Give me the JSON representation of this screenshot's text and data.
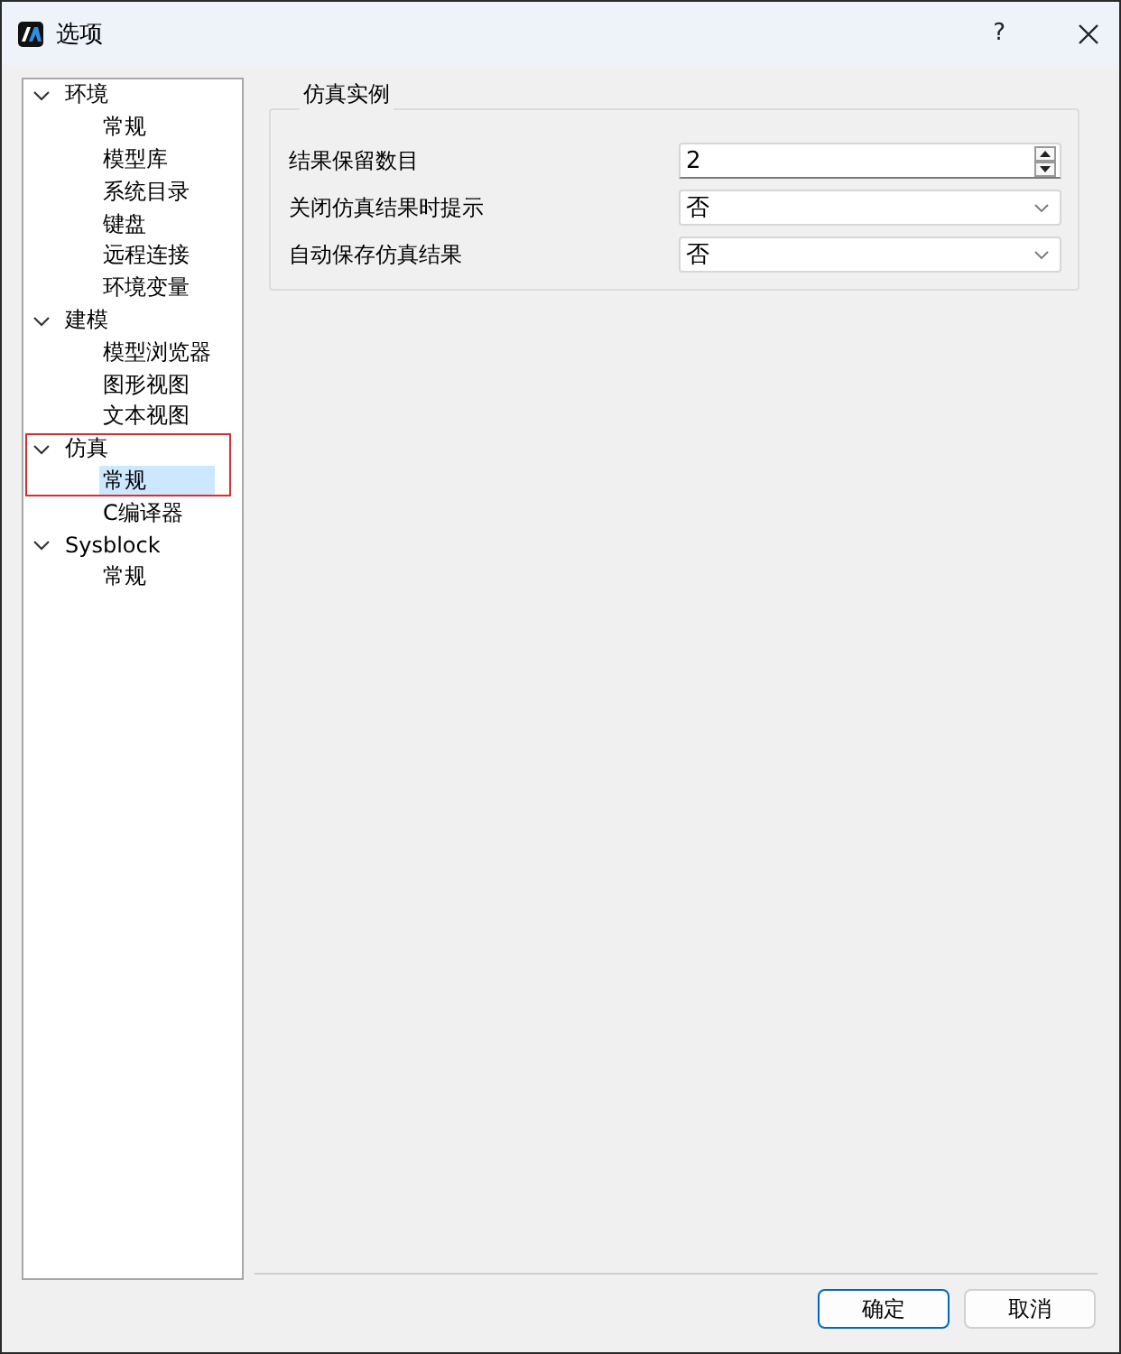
{
  "window": {
    "title": "选项",
    "help_button": "?"
  },
  "tree": [
    {
      "label": "环境",
      "expanded": true,
      "selected": false,
      "framed": false,
      "children": [
        {
          "label": "常规",
          "selected": false,
          "framed": false
        },
        {
          "label": "模型库",
          "selected": false,
          "framed": false
        },
        {
          "label": "系统目录",
          "selected": false,
          "framed": false
        },
        {
          "label": "键盘",
          "selected": false,
          "framed": false
        },
        {
          "label": "远程连接",
          "selected": false,
          "framed": false
        },
        {
          "label": "环境变量",
          "selected": false,
          "framed": false
        }
      ]
    },
    {
      "label": "建模",
      "expanded": true,
      "selected": false,
      "framed": false,
      "children": [
        {
          "label": "模型浏览器",
          "selected": false,
          "framed": false
        },
        {
          "label": "图形视图",
          "selected": false,
          "framed": false
        },
        {
          "label": "文本视图",
          "selected": false,
          "framed": false
        }
      ]
    },
    {
      "label": "仿真",
      "expanded": true,
      "selected": false,
      "framed": true,
      "children": [
        {
          "label": "常规",
          "selected": true,
          "framed": true
        },
        {
          "label": "C编译器",
          "selected": false,
          "framed": false
        }
      ]
    },
    {
      "label": "Sysblock",
      "expanded": true,
      "selected": false,
      "framed": false,
      "children": [
        {
          "label": "常规",
          "selected": false,
          "framed": false
        }
      ]
    }
  ],
  "group": {
    "title": "仿真实例",
    "fields": [
      {
        "kind": "spinbox",
        "label": "结果保留数目",
        "value": "2"
      },
      {
        "kind": "dropdown",
        "label": "关闭仿真结果时提示",
        "value": "否"
      },
      {
        "kind": "dropdown",
        "label": "自动保存仿真结果",
        "value": "否"
      }
    ]
  },
  "buttons": [
    {
      "label": "确定",
      "default": true
    },
    {
      "label": "取消",
      "default": false
    }
  ]
}
